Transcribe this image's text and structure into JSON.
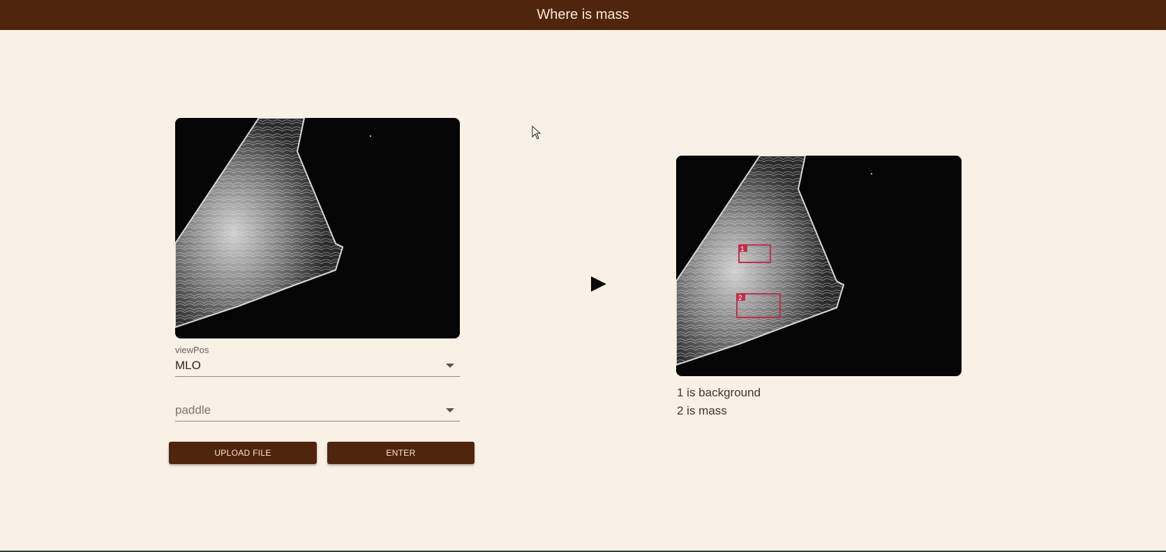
{
  "app": {
    "title": "Where is mass"
  },
  "form": {
    "view_pos_label": "viewPos",
    "view_pos_value": "MLO",
    "model_placeholder": "paddle"
  },
  "buttons": {
    "upload_label": "UPLOAD FILE",
    "enter_label": "ENTER"
  },
  "result": {
    "legend": [
      "1 is background",
      "2 is mass"
    ],
    "box_labels": [
      "1",
      "2"
    ]
  },
  "colors": {
    "appbar": "#4f250b",
    "page_bg": "#f9f1e6",
    "box": "#c0304a"
  },
  "icons": {
    "arrow": "play-arrow-icon",
    "cursor": "mouse-cursor-icon"
  }
}
